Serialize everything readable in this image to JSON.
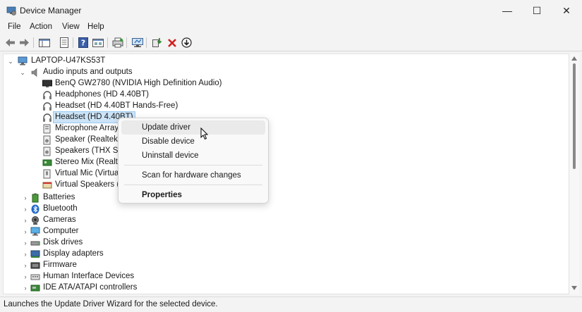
{
  "window": {
    "title": "Device Manager",
    "controls": {
      "minimize": "—",
      "maximize": "☐",
      "close": "✕"
    }
  },
  "menubar": {
    "items": [
      "File",
      "Action",
      "View",
      "Help"
    ]
  },
  "toolbar": {
    "buttons": [
      "back-icon",
      "forward-icon",
      "show-hide-console-tree-icon",
      "properties-icon",
      "help-icon",
      "view-icon",
      "print-icon",
      "scan-hardware-icon",
      "update-driver-icon",
      "uninstall-icon",
      "download-icon"
    ]
  },
  "tree": {
    "root": "LAPTOP-U47KS53T",
    "audio_category": "Audio inputs and outputs",
    "audio_devices": [
      "BenQ GW2780 (NVIDIA High Definition Audio)",
      "Headphones (HD 4.40BT)",
      "Headset (HD 4.40BT Hands-Free)",
      "Headset (HD 4.40BT)",
      "Microphone Array (",
      "Speaker (Realtek(R)",
      "Speakers (THX Spat",
      "Stereo Mix (Realtek",
      "Virtual Mic (Virtual",
      "Virtual Speakers (Vi"
    ],
    "categories": [
      "Batteries",
      "Bluetooth",
      "Cameras",
      "Computer",
      "Disk drives",
      "Display adapters",
      "Firmware",
      "Human Interface Devices",
      "IDE ATA/ATAPI controllers"
    ]
  },
  "context_menu": {
    "update_driver": "Update driver",
    "disable_device": "Disable device",
    "uninstall_device": "Uninstall device",
    "scan_hardware": "Scan for hardware changes",
    "properties": "Properties"
  },
  "status_bar": {
    "text": "Launches the Update Driver Wizard for the selected device."
  },
  "colors": {
    "selection": "#cce4f7",
    "window_bg": "#f3f3f3",
    "tree_bg": "#ffffff"
  }
}
